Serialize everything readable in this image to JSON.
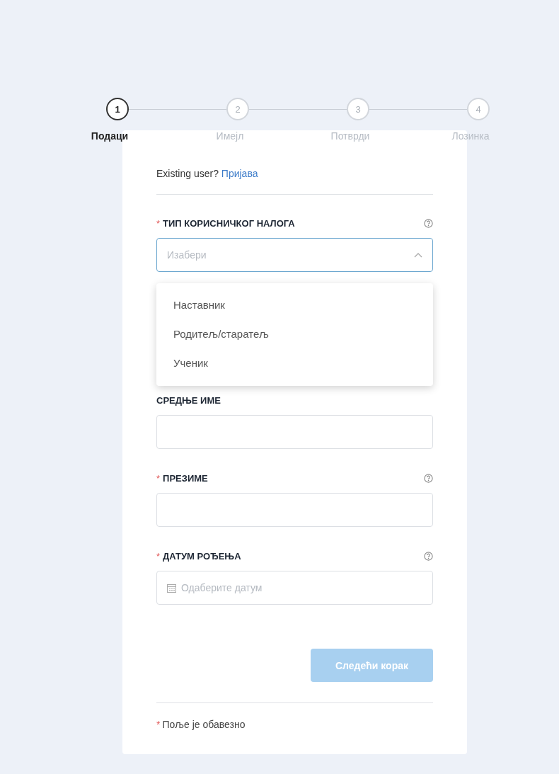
{
  "steps": [
    {
      "number": "1",
      "label": "Подаци",
      "selected": true
    },
    {
      "number": "2",
      "label": "Имејл",
      "selected": false
    },
    {
      "number": "3",
      "label": "Потврди",
      "selected": false
    },
    {
      "number": "4",
      "label": "Лозинка",
      "selected": false
    }
  ],
  "required_mark": "*",
  "login_prompt": {
    "text": "Existing user?",
    "link": "Пријава"
  },
  "fields": [
    {
      "kind": "select",
      "label": "ТИП КОРИСНИЧКОГ НАЛОГА",
      "required": true,
      "help": true,
      "placeholder": "Изабери",
      "expanded": true,
      "options": [
        "Наставник",
        "Родитељ/старатељ",
        "Ученик"
      ]
    },
    {
      "kind": "text",
      "label": "СРЕДЊЕ ИМЕ",
      "required": false,
      "help": false
    },
    {
      "kind": "text",
      "label": "ПРЕЗИМЕ",
      "required": true,
      "help": true
    },
    {
      "kind": "date",
      "label": "ДАТУМ РОЂЕЊА",
      "required": true,
      "help": true,
      "placeholder": "Одаберите датум"
    }
  ],
  "next_button": {
    "label": "Следећи корак",
    "disabled": true
  },
  "required_note": "Поље је обавезно"
}
